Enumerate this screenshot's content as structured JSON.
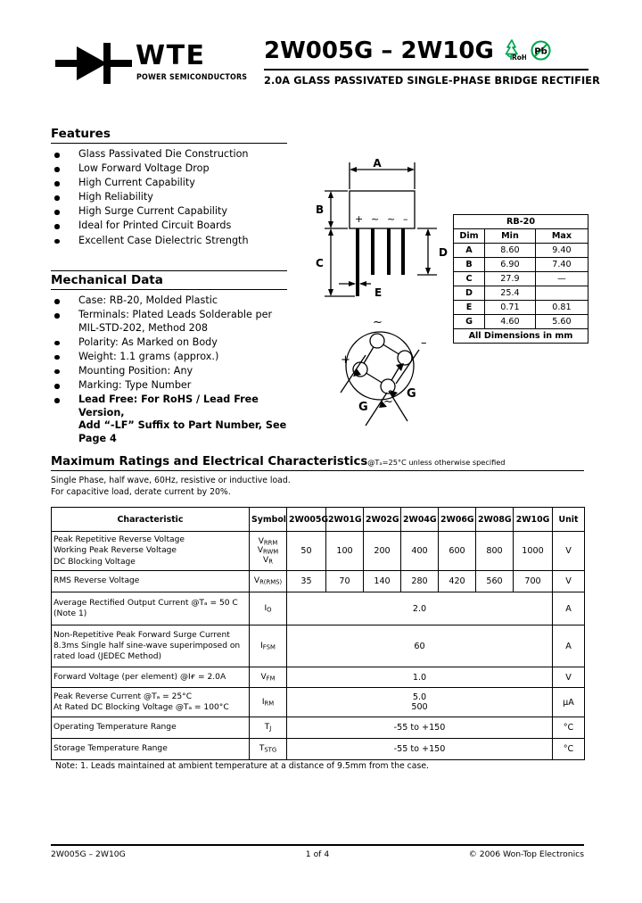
{
  "brand": {
    "name": "WTE",
    "tagline": "POWER SEMICONDUCTORS",
    "logo_icon": "diode-symbol-icon"
  },
  "header": {
    "part_range": "2W005G  –  2W10G",
    "subtitle": "2.0A  GLASS  PASSIVATED  SINGLE-PHASE  BRIDGE  RECTIFIER",
    "rohs_icon_label": "RoHS",
    "pb_icon_label": "Pb",
    "eco_color": "#00a651"
  },
  "features": {
    "heading": "Features",
    "items": [
      "Glass Passivated Die Construction",
      "Low Forward Voltage Drop",
      "High Current Capability",
      "High Reliability",
      "High Surge Current Capability",
      "Ideal for Printed Circuit Boards",
      "Excellent Case Dielectric Strength"
    ]
  },
  "mechanical": {
    "heading": "Mechanical Data",
    "items": [
      {
        "line1": "Case: RB-20, Molded Plastic",
        "line2": "",
        "bold": false
      },
      {
        "line1": "Terminals: Plated Leads Solderable per",
        "line2": "MIL-STD-202, Method 208",
        "bold": false
      },
      {
        "line1": "Polarity: As Marked on Body",
        "line2": "",
        "bold": false
      },
      {
        "line1": "Weight: 1.1 grams (approx.)",
        "line2": "",
        "bold": false
      },
      {
        "line1": "Mounting Position: Any",
        "line2": "",
        "bold": false
      },
      {
        "line1": "Marking: Type Number",
        "line2": "",
        "bold": false
      },
      {
        "line1": "Lead Free: For RoHS / Lead Free Version,",
        "line2": "Add “-LF” Suffix to Part Number, See Page 4",
        "bold": true
      }
    ]
  },
  "package_diagram": {
    "labels": {
      "a": "A",
      "b": "B",
      "c": "C",
      "d": "D",
      "e": "E"
    },
    "terminal_marks": [
      "+",
      "~",
      "~",
      "–"
    ],
    "bottom_view_labels": {
      "plus": "+",
      "minus": "–",
      "ac1": "~",
      "ac2": "~",
      "g1": "G",
      "g2": "G"
    }
  },
  "dim_table": {
    "title": "RB-20",
    "headers": [
      "Dim",
      "Min",
      "Max"
    ],
    "rows": [
      {
        "dim": "A",
        "min": "8.60",
        "max": "9.40"
      },
      {
        "dim": "B",
        "min": "6.90",
        "max": "7.40"
      },
      {
        "dim": "C",
        "min": "27.9",
        "max": "—"
      },
      {
        "dim": "D",
        "min": "25.4",
        "max": ""
      },
      {
        "dim": "E",
        "min": "0.71",
        "max": "0.81"
      },
      {
        "dim": "G",
        "min": "4.60",
        "max": "5.60"
      }
    ],
    "footer": "All Dimensions in mm"
  },
  "ratings": {
    "title": "Maximum Ratings and Electrical Characteristics",
    "condition": "@Tₐ=25°C unless otherwise specified",
    "note_line1": "Single Phase, half wave, 60Hz, resistive or inductive load.",
    "note_line2": "For capacitive load, derate current by 20%.",
    "columns": [
      "Characteristic",
      "Symbol",
      "2W005G",
      "2W01G",
      "2W02G",
      "2W04G",
      "2W06G",
      "2W08G",
      "2W10G",
      "Unit"
    ],
    "rows": [
      {
        "characteristic_lines": [
          "Peak Repetitive Reverse Voltage",
          "Working Peak Reverse Voltage",
          "DC Blocking Voltage"
        ],
        "symbol_lines": [
          "V",
          "RRM",
          "V",
          "RWM",
          "V",
          "R"
        ],
        "values": [
          "50",
          "100",
          "200",
          "400",
          "600",
          "800",
          "1000"
        ],
        "unit": "V"
      },
      {
        "characteristic_lines": [
          "RMS Reverse Voltage"
        ],
        "symbol_lines": [
          "V",
          "R(RMS)"
        ],
        "values": [
          "35",
          "70",
          "140",
          "280",
          "420",
          "560",
          "700"
        ],
        "unit": "V"
      },
      {
        "characteristic_lines": [
          "Average Rectified Output Current  @Tₐ = 50 C",
          "(Note 1)"
        ],
        "symbol_lines": [
          "I",
          "O"
        ],
        "span_value": "2.0",
        "unit": "A"
      },
      {
        "characteristic_lines": [
          "Non-Repetitive Peak Forward Surge Current",
          "8.3ms Single half sine-wave superimposed on",
          "rated load (JEDEC Method)"
        ],
        "symbol_lines": [
          "I",
          "FSM"
        ],
        "span_value": "60",
        "unit": "A"
      },
      {
        "characteristic_lines": [
          "Forward Voltage (per element)          @Iғ = 2.0A"
        ],
        "symbol_lines": [
          "V",
          "FM"
        ],
        "span_value": "1.0",
        "unit": "V"
      },
      {
        "characteristic_lines": [
          "Peak Reverse Current              @Tₐ = 25°C",
          "At Rated DC Blocking Voltage   @Tₐ = 100°C"
        ],
        "symbol_lines": [
          "I",
          "RM"
        ],
        "span_value": "5.0\n500",
        "unit": "µA"
      },
      {
        "characteristic_lines": [
          "Operating Temperature Range"
        ],
        "symbol_lines": [
          "T",
          "J"
        ],
        "span_value": "-55 to +150",
        "unit": "°C"
      },
      {
        "characteristic_lines": [
          "Storage Temperature Range"
        ],
        "symbol_lines": [
          "T",
          "STG"
        ],
        "span_value": "-55 to +150",
        "unit": "°C"
      }
    ],
    "footnote": "Note:  1. Leads maintained at ambient temperature at a distance of 9.5mm from the case."
  },
  "footer": {
    "left": "2W005G – 2W10G",
    "center": "1 of 4",
    "right": "© 2006 Won-Top Electronics"
  }
}
